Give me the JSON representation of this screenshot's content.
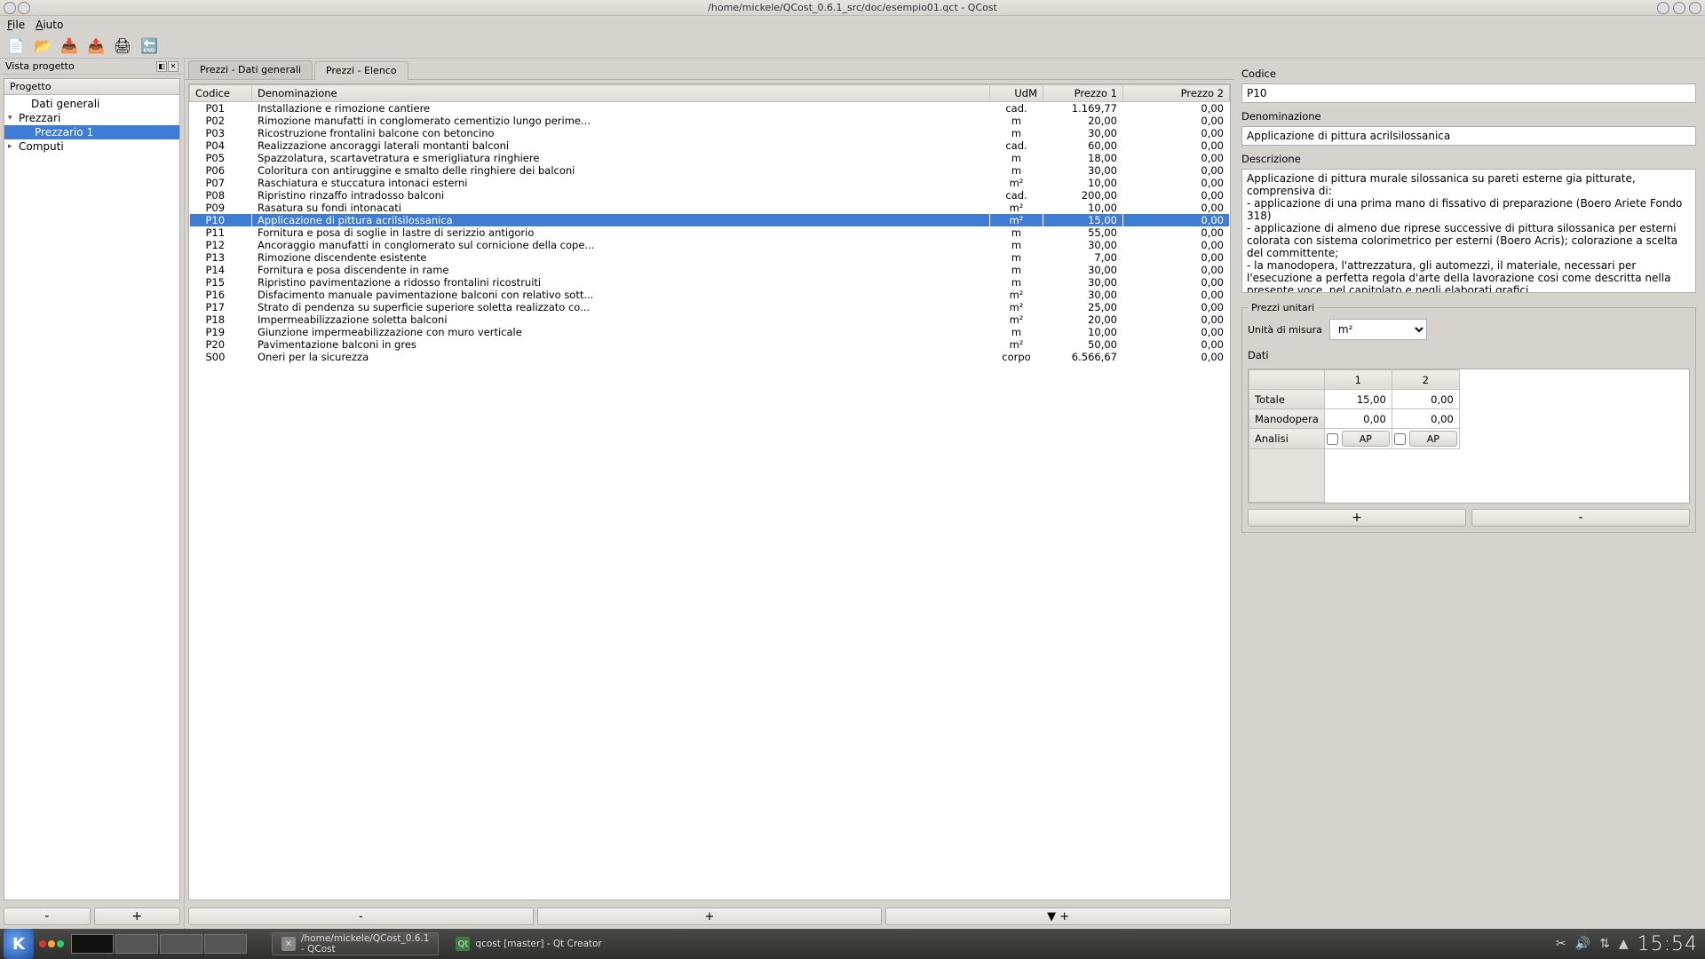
{
  "window": {
    "title": "/home/mickele/QCost_0.6.1_src/doc/esempio01.qct - QCost"
  },
  "menubar": {
    "file": "File",
    "help": "Aiuto"
  },
  "project_panel": {
    "title": "Vista progetto",
    "header": "Progetto",
    "items": {
      "dati_generali": "Dati generali",
      "prezzari": "Prezzari",
      "prezzario1": "Prezzario 1",
      "computi": "Computi"
    },
    "minus": "-",
    "plus": "+"
  },
  "tabs": {
    "dati": "Prezzi - Dati generali",
    "elenco": "Prezzi - Elenco"
  },
  "grid": {
    "headers": {
      "codice": "Codice",
      "denom": "Denominazione",
      "udm": "UdM",
      "p1": "Prezzo 1",
      "p2": "Prezzo 2"
    },
    "rows": [
      {
        "c": "P01",
        "d": "Installazione e rimozione cantiere",
        "u": "cad.",
        "p1": "1.169,77",
        "p2": "0,00"
      },
      {
        "c": "P02",
        "d": "Rimozione manufatti in conglomerato cementizio lungo perime...",
        "u": "m",
        "p1": "20,00",
        "p2": "0,00"
      },
      {
        "c": "P03",
        "d": "Ricostruzione frontalini balcone con betoncino",
        "u": "m",
        "p1": "30,00",
        "p2": "0,00"
      },
      {
        "c": "P04",
        "d": "Realizzazione ancoraggi laterali montanti balconi",
        "u": "cad.",
        "p1": "60,00",
        "p2": "0,00"
      },
      {
        "c": "P05",
        "d": "Spazzolatura, scartavetratura e smerigliatura ringhiere",
        "u": "m",
        "p1": "18,00",
        "p2": "0,00"
      },
      {
        "c": "P06",
        "d": "Coloritura con antiruggine e smalto delle ringhiere dei balconi",
        "u": "m",
        "p1": "30,00",
        "p2": "0,00"
      },
      {
        "c": "P07",
        "d": "Raschiatura e stuccatura intonaci esterni",
        "u": "m²",
        "p1": "10,00",
        "p2": "0,00"
      },
      {
        "c": "P08",
        "d": "Ripristino rinzaffo intradosso balconi",
        "u": "cad.",
        "p1": "200,00",
        "p2": "0,00"
      },
      {
        "c": "P09",
        "d": "Rasatura su fondi intonacati",
        "u": "m²",
        "p1": "10,00",
        "p2": "0,00"
      },
      {
        "c": "P10",
        "d": "Applicazione di pittura acrilsilossanica",
        "u": "m²",
        "p1": "15,00",
        "p2": "0,00",
        "sel": true
      },
      {
        "c": "P11",
        "d": "Fornitura e posa di soglie in lastre di serizzio antigorio",
        "u": "m",
        "p1": "55,00",
        "p2": "0,00"
      },
      {
        "c": "P12",
        "d": "Ancoraggio manufatti in conglomerato sul cornicione della cope...",
        "u": "m",
        "p1": "30,00",
        "p2": "0,00"
      },
      {
        "c": "P13",
        "d": "Rimozione discendente esistente",
        "u": "m",
        "p1": "7,00",
        "p2": "0,00"
      },
      {
        "c": "P14",
        "d": "Fornitura e posa discendente in rame",
        "u": "m",
        "p1": "30,00",
        "p2": "0,00"
      },
      {
        "c": "P15",
        "d": "Ripristino pavimentazione a ridosso frontalini ricostruiti",
        "u": "m",
        "p1": "30,00",
        "p2": "0,00"
      },
      {
        "c": "P16",
        "d": "Disfacimento manuale pavimentazione balconi con relativo sott...",
        "u": "m²",
        "p1": "30,00",
        "p2": "0,00"
      },
      {
        "c": "P17",
        "d": "Strato di pendenza su superficie superiore soletta realizzato co...",
        "u": "m²",
        "p1": "25,00",
        "p2": "0,00"
      },
      {
        "c": "P18",
        "d": "Impermeabilizzazione soletta balconi",
        "u": "m²",
        "p1": "20,00",
        "p2": "0,00"
      },
      {
        "c": "P19",
        "d": "Giunzione impermeabilizzazione con muro verticale",
        "u": "m",
        "p1": "10,00",
        "p2": "0,00"
      },
      {
        "c": "P20",
        "d": "Pavimentazione balconi in gres",
        "u": "m²",
        "p1": "50,00",
        "p2": "0,00"
      },
      {
        "c": "S00",
        "d": "Oneri per la sicurezza",
        "u": "corpo",
        "p1": "6.566,67",
        "p2": "0,00"
      }
    ]
  },
  "center_btns": {
    "minus": "-",
    "plus": "+",
    "arrowplus": "▼ +"
  },
  "detail": {
    "codice_label": "Codice",
    "codice_value": "P10",
    "denom_label": "Denominazione",
    "denom_value": "Applicazione di pittura acrilsilossanica",
    "descr_label": "Descrizione",
    "descr_value": "Applicazione di pittura murale silossanica su pareti esterne gia pitturate, comprensiva di:\n- applicazione di una prima mano di fissativo di preparazione (Boero Ariete Fondo 318)\n- applicazione di almeno due riprese successive di pittura silossanica per esterni colorata con sistema colorimetrico per esterni (Boero Acris); colorazione a scelta del committente;\n- la manodopera, l'attrezzatura, gli automezzi, il materiale, necessari per l'esecuzione a perfetta regola d'arte della lavorazione cosi come descritta nella presente voce, nel capitolato e negli elaborati grafici.\nValutato per metro quadro di parete sottoposta all'intero ciclo sopra descritto.",
    "prezzi_label": "Prezzi unitari",
    "um_label": "Unità di misura",
    "um_value": "m²",
    "dati_label": "Dati",
    "dati": {
      "col1": "1",
      "col2": "2",
      "totale_label": "Totale",
      "totale_1": "15,00",
      "totale_2": "0,00",
      "mano_label": "Manodopera",
      "mano_1": "0,00",
      "mano_2": "0,00",
      "analisi_label": "Analisi",
      "ap": "AP"
    },
    "plus": "+",
    "minus": "-"
  },
  "taskbar": {
    "app1_line1": "/home/mickele/QCost_0.6.1",
    "app1_line2": "- QCost",
    "app2": "qcost [master] - Qt Creator",
    "clock": "15:54"
  }
}
